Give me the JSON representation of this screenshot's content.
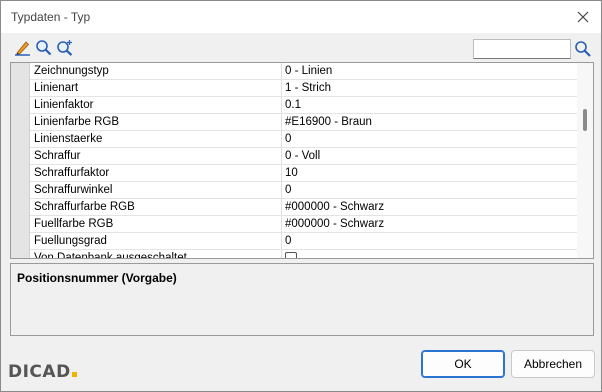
{
  "window": {
    "title": "Typdaten - Typ"
  },
  "toolbar": {
    "icons": [
      "edit-icon",
      "zoom-icon",
      "zoom-plus-icon"
    ],
    "search": {
      "value": "",
      "placeholder": ""
    }
  },
  "properties": [
    {
      "key": "Zeichnungstyp",
      "value": "0 - Linien"
    },
    {
      "key": "Linienart",
      "value": "1 - Strich"
    },
    {
      "key": "Linienfaktor",
      "value": "0.1"
    },
    {
      "key": "Linienfarbe RGB",
      "value": "#E16900 - Braun"
    },
    {
      "key": "Linienstaerke",
      "value": "0"
    },
    {
      "key": "Schraffur",
      "value": "0 - Voll"
    },
    {
      "key": "Schraffurfaktor",
      "value": "10"
    },
    {
      "key": "Schraffurwinkel",
      "value": "0"
    },
    {
      "key": "Schraffurfarbe RGB",
      "value": "#000000 - Schwarz"
    },
    {
      "key": "Fuellfarbe RGB",
      "value": "#000000 - Schwarz"
    },
    {
      "key": "Fuellungsgrad",
      "value": "0"
    },
    {
      "key": "Von Datenbank ausgeschaltet",
      "value": "",
      "checkbox": true,
      "checked": false
    }
  ],
  "description": {
    "title": "Positionsnummer (Vorgabe)"
  },
  "footer": {
    "logo": "DICAD",
    "ok_label": "OK",
    "cancel_label": "Abbrechen"
  },
  "colors": {
    "accent": "#2b73d1",
    "logo_dot": "#f0b400"
  }
}
